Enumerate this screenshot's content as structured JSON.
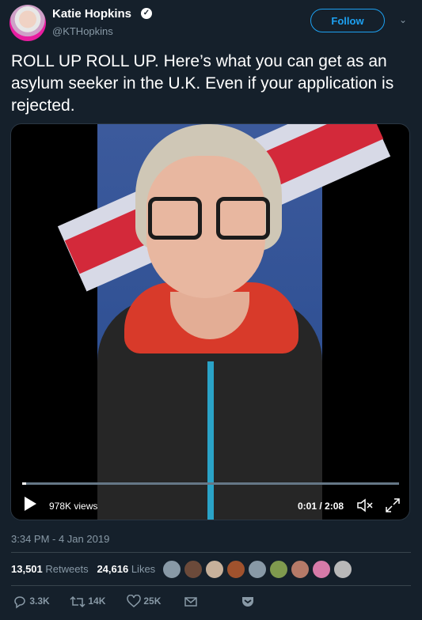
{
  "user": {
    "name": "Katie Hopkins",
    "handle": "@KTHopkins",
    "follow_label": "Follow"
  },
  "tweet": {
    "text": "ROLL UP ROLL UP. Here’s what you can get as an asylum seeker in the U.K.  Even if your application is rejected.",
    "timestamp": "3:34 PM - 4 Jan 2019"
  },
  "video": {
    "views": "978K views",
    "time": "0:01 / 2:08",
    "progress": 0.01
  },
  "stats": {
    "retweets_count": "13,501",
    "retweets_label": "Retweets",
    "likes_count": "24,616",
    "likes_label": "Likes"
  },
  "actions": {
    "reply_count": "3.3K",
    "retweet_count": "14K",
    "like_count": "25K"
  },
  "colors": {
    "background": "#15202b",
    "accent": "#1da1f2",
    "muted": "#8899a6"
  },
  "likers": [
    "#8899a6",
    "#6b4a3a",
    "#c7b19b",
    "#a0522d",
    "#8899a6",
    "#7f9a4e",
    "#b57a68",
    "#d67aa8",
    "#b8b8b8"
  ]
}
